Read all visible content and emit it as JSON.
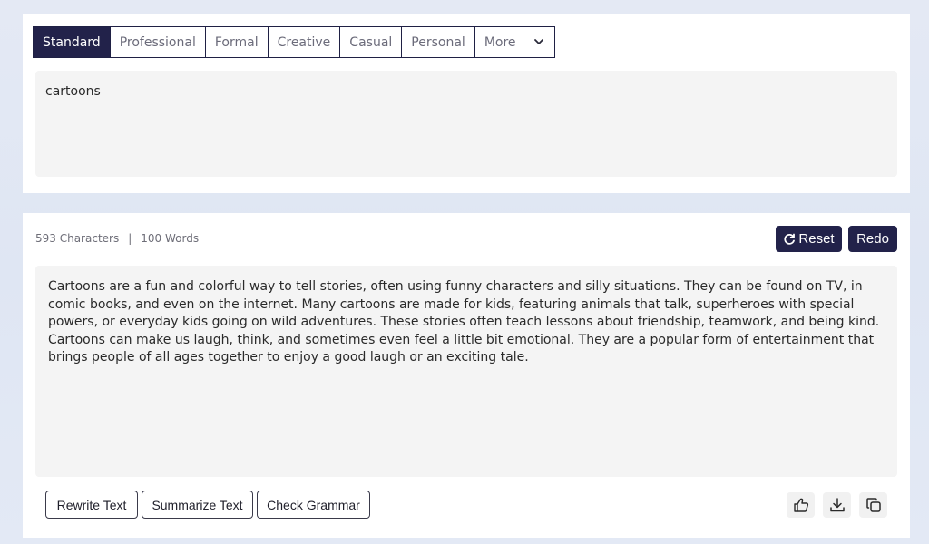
{
  "tabs": [
    {
      "label": "Standard",
      "active": true
    },
    {
      "label": "Professional",
      "active": false
    },
    {
      "label": "Formal",
      "active": false
    },
    {
      "label": "Creative",
      "active": false
    },
    {
      "label": "Casual",
      "active": false
    },
    {
      "label": "Personal",
      "active": false
    }
  ],
  "more_label": "More",
  "input_text": "cartoons",
  "stats": {
    "characters": "593 Characters",
    "separator": "|",
    "words": "100 Words"
  },
  "buttons": {
    "reset": "Reset",
    "redo": "Redo",
    "rewrite": "Rewrite Text",
    "summarize": "Summarize Text",
    "grammar": "Check Grammar"
  },
  "output_text": "Cartoons are a fun and colorful way to tell stories, often using funny characters and silly situations. They can be found on TV, in comic books, and even on the internet. Many cartoons are made for kids, featuring animals that talk, superheroes with special powers, or everyday kids going on wild adventures. These stories often teach lessons about friendship, teamwork, and being kind. Cartoons can make us laugh, think, and sometimes even feel a little bit emotional. They are a popular form of entertainment that brings people of all ages together to enjoy a good laugh or an exciting tale.",
  "icons": {
    "reset": "refresh-icon",
    "more": "chevron-down-icon",
    "like": "thumbs-up-icon",
    "download": "download-icon",
    "copy": "copy-icon"
  },
  "colors": {
    "accent": "#22224a",
    "box_bg": "#f4f4f4"
  }
}
